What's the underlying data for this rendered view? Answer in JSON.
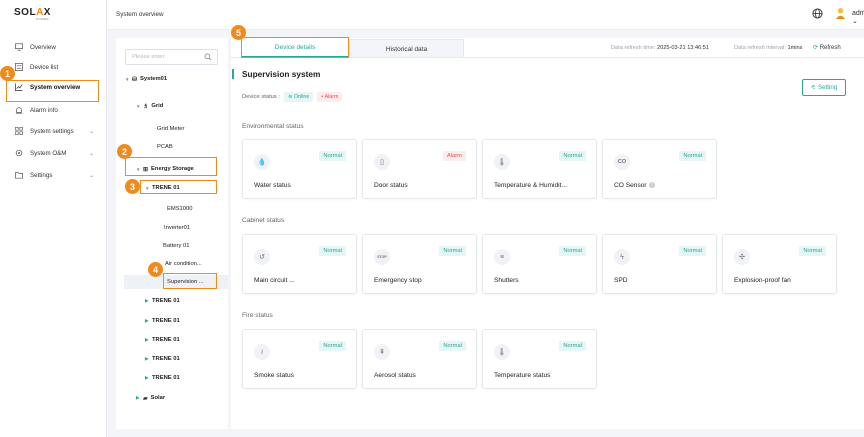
{
  "brand": {
    "logo": "SOLAX",
    "logo_sub": "POWER"
  },
  "header": {
    "title": "System overview",
    "user": "admin"
  },
  "nav": [
    {
      "label": "Overview",
      "icon": "monitor-icon",
      "chevron": false
    },
    {
      "label": "Device list",
      "icon": "list-icon",
      "chevron": false
    },
    {
      "label": "System overview",
      "icon": "chart-icon",
      "chevron": false,
      "active": true
    },
    {
      "label": "Alarm info",
      "icon": "alarm-icon",
      "chevron": false
    },
    {
      "label": "System settings",
      "icon": "grid-icon",
      "chevron": true
    },
    {
      "label": "System O&M",
      "icon": "wrench-icon",
      "chevron": true
    },
    {
      "label": "Settings",
      "icon": "folder-icon",
      "chevron": true
    }
  ],
  "search": {
    "placeholder": "Please enter"
  },
  "tree": [
    {
      "label": "System01",
      "arrow": "▼",
      "icon": "⛁",
      "bold": true
    },
    {
      "label": "Grid",
      "arrow": "▼",
      "icon": "♗",
      "bold": true
    },
    {
      "label": "Grid Meter"
    },
    {
      "label": "PCAB"
    },
    {
      "label": "Energy Storage",
      "arrow": "▼",
      "icon": "⊞",
      "bold": true
    },
    {
      "label": "TRENE 01",
      "arrow": "▼",
      "bold": true
    },
    {
      "label": "EMS1000"
    },
    {
      "label": "Inverter01"
    },
    {
      "label": "Battery 01"
    },
    {
      "label": "Air condition..."
    },
    {
      "label": "Supervision ...",
      "selected": true
    },
    {
      "label": "TRENE 01",
      "arrow": "▶",
      "bold": true
    },
    {
      "label": "TRENE 01",
      "arrow": "▶",
      "bold": true
    },
    {
      "label": "TRENE 01",
      "arrow": "▶",
      "bold": true
    },
    {
      "label": "TRENE 01",
      "arrow": "▶",
      "bold": true
    },
    {
      "label": "TRENE 01",
      "arrow": "▶",
      "bold": true
    },
    {
      "label": "Solar",
      "arrow": "▶",
      "icon": "▰",
      "bold": true
    }
  ],
  "tabs": {
    "details": "Device details",
    "history": "Historical data"
  },
  "refresh": {
    "time_label": "Data refresh time:",
    "time_value": "2025-03-21 13:46:51",
    "interval_label": "Data refresh interval:",
    "interval_value": "1mins",
    "button": "Refresh"
  },
  "section": {
    "title": "Supervision system",
    "status_label": "Device status :",
    "online": "Online",
    "alarm": "Alarm",
    "setting": "Setting"
  },
  "groups": [
    {
      "title": "Environmental status",
      "cards": [
        {
          "label": "Water status",
          "status": "Normal",
          "icon": "water-drop-icon",
          "glyph": "💧"
        },
        {
          "label": "Door status",
          "status": "Alarm",
          "icon": "door-icon",
          "glyph": "▯"
        },
        {
          "label": "Temperature & Humidit...",
          "status": "Normal",
          "icon": "temperature-humidity-icon",
          "glyph": "🌡"
        },
        {
          "label": "CO Sensor",
          "status": "Normal",
          "icon": "co-icon",
          "glyph": "CO",
          "help": "?"
        }
      ]
    },
    {
      "title": "Cabinet status",
      "cards": [
        {
          "label": "Main circuit ...",
          "status": "Normal",
          "icon": "circuit-icon",
          "glyph": "↺"
        },
        {
          "label": "Emergency stop",
          "status": "Normal",
          "icon": "stop-icon",
          "glyph": "STOP"
        },
        {
          "label": "Shutters",
          "status": "Normal",
          "icon": "shutters-icon",
          "glyph": "≡"
        },
        {
          "label": "SPD",
          "status": "Normal",
          "icon": "lightning-icon",
          "glyph": "ϟ"
        },
        {
          "label": "Explosion-proof fan",
          "status": "Normal",
          "icon": "fan-icon",
          "glyph": "✣"
        }
      ]
    },
    {
      "title": "Fire status",
      "cards": [
        {
          "label": "Smoke status",
          "status": "Normal",
          "icon": "smoke-icon",
          "glyph": "≀"
        },
        {
          "label": "Aerosol status",
          "status": "Normal",
          "icon": "aerosol-icon",
          "glyph": "⇞"
        },
        {
          "label": "Temperature status",
          "status": "Normal",
          "icon": "thermometer-icon",
          "glyph": "🌡"
        }
      ]
    }
  ],
  "steps": [
    "1",
    "2",
    "3",
    "4",
    "5"
  ],
  "colors": {
    "accent": "#2aa69c",
    "alarm": "#e55353",
    "callout": "#f08a1c"
  }
}
